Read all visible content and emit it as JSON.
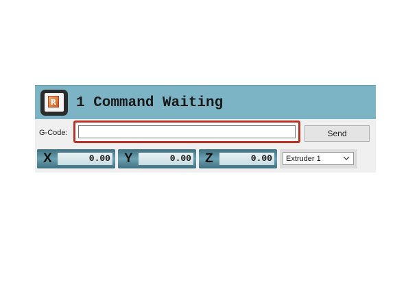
{
  "status": {
    "title": "1 Command Waiting",
    "logo_letter": "R",
    "logo_icon": "repetier-logo-icon",
    "background_color": "#7cb3c5"
  },
  "gcode": {
    "label": "G-Code:",
    "value": "",
    "placeholder": "",
    "send_label": "Send",
    "highlight_color": "#b83324"
  },
  "coordinates": [
    {
      "axis": "X",
      "value": "0.00"
    },
    {
      "axis": "Y",
      "value": "0.00"
    },
    {
      "axis": "Z",
      "value": "0.00"
    }
  ],
  "extruder": {
    "selected": "Extruder 1",
    "icon": "chevron-down-icon"
  }
}
